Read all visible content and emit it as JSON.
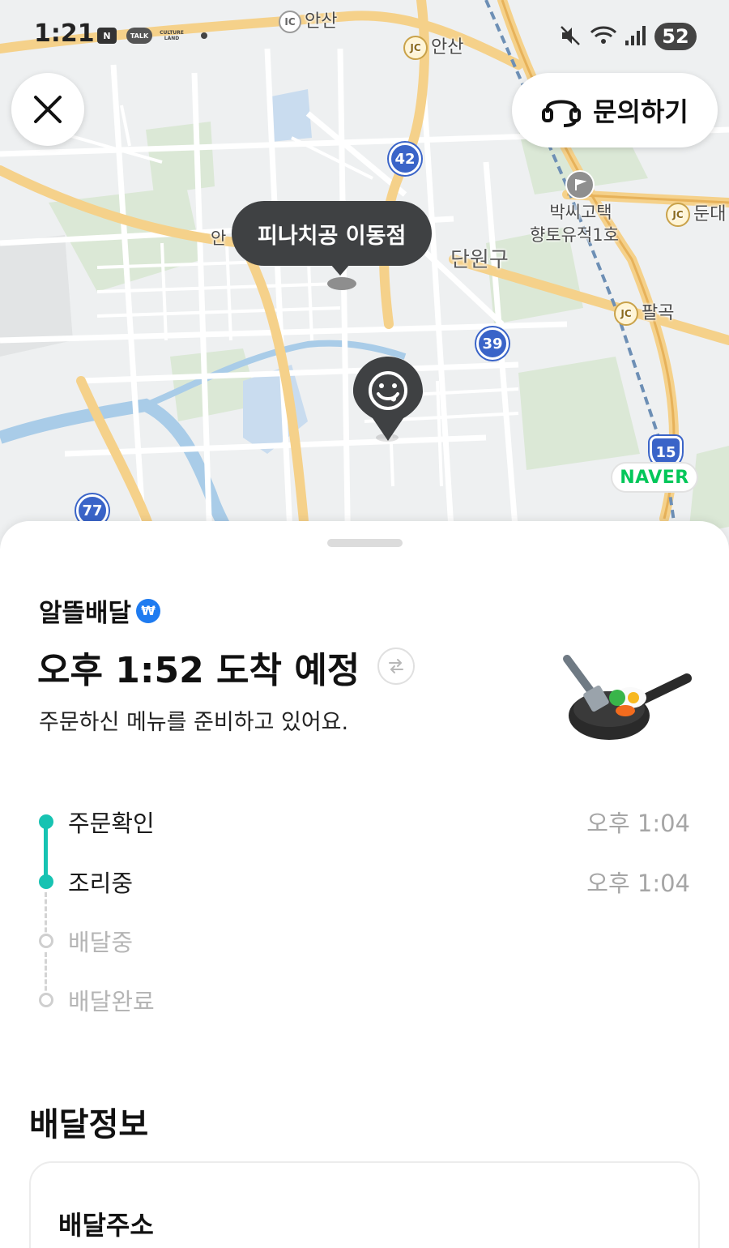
{
  "status_bar": {
    "time": "1:21",
    "app_icons": [
      "N",
      "TALK",
      "CULTURE LAND"
    ],
    "battery": "52"
  },
  "map": {
    "labels": {
      "ic_ansan": "안산",
      "jc_ansan": "안산",
      "jc_dundae": "둔대",
      "jc_palgok": "팔곡",
      "park_house_line1": "박씨고택",
      "park_house_line2": "향토유적1호",
      "district": "단원구",
      "an_partial": "안"
    },
    "route_shields": [
      "42",
      "39",
      "77",
      "15"
    ],
    "store_tooltip": "피나치공 이동점",
    "provider": "NAVER"
  },
  "header": {
    "inquiry_label": "문의하기"
  },
  "order": {
    "service_name": "알뜰배달",
    "eta_title": "오후 1:52 도착 예정",
    "status_message": "주문하신 메뉴를 준비하고 있어요.",
    "steps": [
      {
        "label": "주문확인",
        "time": "오후 1:04",
        "done": true
      },
      {
        "label": "조리중",
        "time": "오후 1:04",
        "done": true
      },
      {
        "label": "배달중",
        "time": "",
        "done": false
      },
      {
        "label": "배달완료",
        "time": "",
        "done": false
      }
    ]
  },
  "delivery_info": {
    "heading": "배달정보",
    "address_label": "배달주소"
  },
  "colors": {
    "accent_teal": "#17c3b2",
    "naver_green": "#03c75a",
    "tooltip_bg": "#3f4143",
    "route_blue": "#3a64c8"
  },
  "icons": {
    "close": "close-icon",
    "headset": "headset-icon",
    "verified": "verified-badge-icon",
    "refresh": "refresh-icon",
    "destination": "smiley-pin-icon",
    "illustration": "frying-pan-icon"
  }
}
